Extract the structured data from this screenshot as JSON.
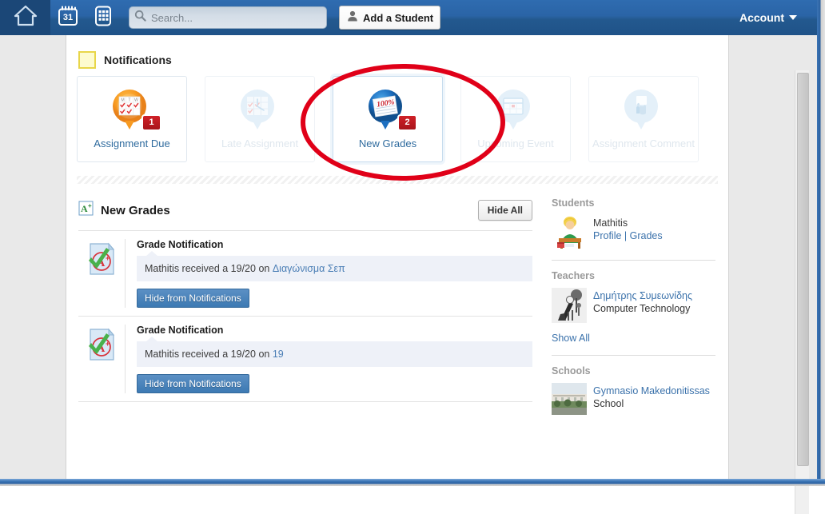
{
  "toolbar": {
    "home_icon": "home-icon",
    "calendar_icon": "calendar-icon",
    "calendar_day": "31",
    "apps_icon": "apps-grid-icon",
    "search_placeholder": "Search...",
    "search_value": "",
    "search_icon": "search-icon",
    "add_student_label": "Add a Student",
    "add_student_icon": "user-silhouette-icon",
    "account_label": "Account",
    "account_caret_icon": "chevron-down-icon"
  },
  "notifications": {
    "section_title": "Notifications",
    "swatch_color": "#fdfbcf",
    "cards": [
      {
        "label": "Assignment Due",
        "icon": "calendar-checkmarks-icon",
        "badge": "1",
        "state": "enabled",
        "selected": false
      },
      {
        "label": "Late Assignment",
        "icon": "clock-checkmarks-icon",
        "badge": "",
        "state": "disabled",
        "selected": false
      },
      {
        "label": "New Grades",
        "icon": "grade-paper-100-icon",
        "badge": "2",
        "state": "enabled",
        "selected": true
      },
      {
        "label": "Upcoming Event",
        "icon": "calendar-event-icon",
        "badge": "",
        "state": "disabled",
        "selected": false
      },
      {
        "label": "Assignment Comment",
        "icon": "comment-hand-icon",
        "badge": "",
        "state": "disabled",
        "selected": false
      }
    ]
  },
  "panel": {
    "icon": "grade-a-plus-icon",
    "title": "New Grades",
    "hide_all_label": "Hide All",
    "rows": [
      {
        "icon": "grade-a-plus-document-icon",
        "title": "Grade Notification",
        "message_prefix": "Mathitis received a 19/20 on ",
        "message_link": "Διαγώνισμα Σεπ",
        "hide_label": "Hide from Notifications"
      },
      {
        "icon": "grade-a-plus-document-icon",
        "title": "Grade Notification",
        "message_prefix": "Mathitis received a 19/20 on ",
        "message_link": "19",
        "hide_label": "Hide from Notifications"
      }
    ]
  },
  "sidebar": {
    "students": {
      "title": "Students",
      "entries": [
        {
          "avatar": "student-boy-desk-avatar",
          "name": "Mathitis",
          "link_profile": "Profile",
          "link_separator": " | ",
          "link_grades": "Grades"
        }
      ]
    },
    "teachers": {
      "title": "Teachers",
      "entries": [
        {
          "avatar": "teacher-photo-avatar",
          "name": "Δημήτρης Συμεωνίδης",
          "subtitle": "Computer Technology"
        }
      ],
      "show_all_label": "Show All"
    },
    "schools": {
      "title": "Schools",
      "entries": [
        {
          "avatar": "school-building-photo-avatar",
          "name": "Gymnasio Makedonitissas",
          "subtitle": "School"
        }
      ]
    }
  },
  "annotation": {
    "shape": "ellipse",
    "color": "#e00018",
    "targets": "New Grades"
  },
  "colors": {
    "topbar_blue": "#2a64a6",
    "home_cell_blue": "#1b4777",
    "link_blue": "#3b72ab",
    "badge_red": "#cf2027",
    "hide_button_blue": "#3d7ab3",
    "message_band": "#eef1f8"
  }
}
